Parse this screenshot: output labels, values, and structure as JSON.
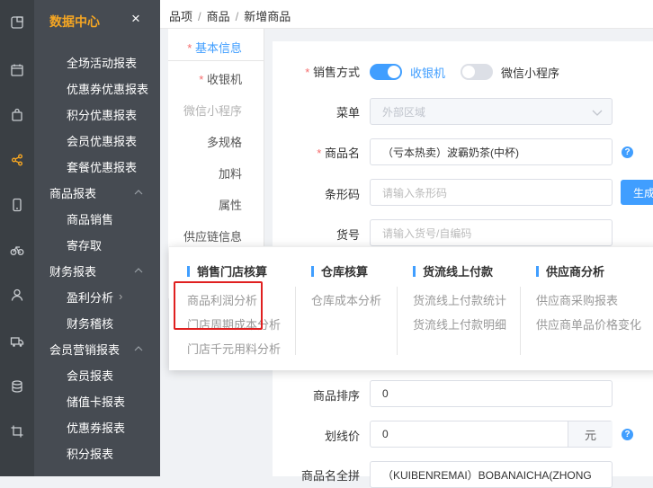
{
  "iconbar": {
    "icons": [
      "dashboard-icon",
      "calendar-icon",
      "bag-icon",
      "share-icon",
      "phone-icon",
      "bicycle-icon",
      "user-icon",
      "truck-icon",
      "database-icon",
      "crop-icon"
    ],
    "active": "share-icon",
    "accent": "#f5a623"
  },
  "sidebar": {
    "title": "数据中心",
    "close": "×",
    "rows": [
      {
        "type": "item",
        "label": "全场活动报表"
      },
      {
        "type": "item",
        "label": "优惠券优惠报表"
      },
      {
        "type": "item",
        "label": "积分优惠报表"
      },
      {
        "type": "item",
        "label": "会员优惠报表"
      },
      {
        "type": "item",
        "label": "套餐优惠报表"
      },
      {
        "type": "group",
        "label": "商品报表"
      },
      {
        "type": "item",
        "label": "商品销售"
      },
      {
        "type": "item",
        "label": "寄存取"
      },
      {
        "type": "group",
        "label": "财务报表"
      },
      {
        "type": "item",
        "label": "盈利分析"
      },
      {
        "type": "item",
        "label": "财务稽核"
      },
      {
        "type": "group",
        "label": "会员营销报表"
      },
      {
        "type": "item",
        "label": "会员报表"
      },
      {
        "type": "item",
        "label": "储值卡报表"
      },
      {
        "type": "item",
        "label": "优惠券报表"
      },
      {
        "type": "item",
        "label": "积分报表"
      }
    ],
    "bg": "#464b52"
  },
  "breadcrumb": {
    "items": [
      "品项",
      "商品",
      "新增商品"
    ],
    "sep": "/"
  },
  "leftnav": {
    "items": [
      {
        "label": "基本信息",
        "required": true,
        "state": "active"
      },
      {
        "label": "收银机",
        "required": true,
        "state": "normal"
      },
      {
        "label": "微信小程序",
        "required": false,
        "state": "disabled"
      },
      {
        "label": "多规格",
        "required": false,
        "state": "normal"
      },
      {
        "label": "加料",
        "required": false,
        "state": "normal"
      },
      {
        "label": "属性",
        "required": false,
        "state": "normal"
      },
      {
        "label": "供应链信息",
        "required": false,
        "state": "normal"
      }
    ],
    "req_mark": "*"
  },
  "form": {
    "sale_mode_label": "销售方式",
    "toggle_pos_label": "收银机",
    "toggle_mini_label": "微信小程序",
    "menu_label": "菜单",
    "menu_value": "外部区域",
    "name_label": "商品名",
    "name_value": "（亏本热卖）波霸奶茶(中杯)",
    "barcode_label": "条形码",
    "barcode_placeholder": "请输入条形码",
    "generate_btn": "生成",
    "sku_label": "货号",
    "sku_placeholder": "请输入货号/自编码",
    "sort_label": "商品排序",
    "sort_value": "0",
    "strike_label": "划线价",
    "strike_value": "0",
    "strike_unit": "元",
    "pinyin_label": "商品名全拼",
    "pinyin_value": "（KUIBENREMAI）BOBANAICHA(ZHONG",
    "help": "?",
    "req_mark": "*"
  },
  "dropdown": {
    "columns": [
      {
        "title": "销售门店核算",
        "links": [
          "商品利润分析",
          "门店周期成本分析",
          "门店千元用料分析"
        ]
      },
      {
        "title": "仓库核算",
        "links": [
          "仓库成本分析"
        ]
      },
      {
        "title": "货流线上付款",
        "links": [
          "货流线上付款统计",
          "货流线上付款明细"
        ]
      },
      {
        "title": "供应商分析",
        "links": [
          "供应商采购报表",
          "供应商单品价格变化"
        ]
      }
    ],
    "highlighted": "商品利润分析"
  },
  "colors": {
    "primary": "#409eff",
    "required": "#f56c6c",
    "highlight": "#e02020"
  }
}
